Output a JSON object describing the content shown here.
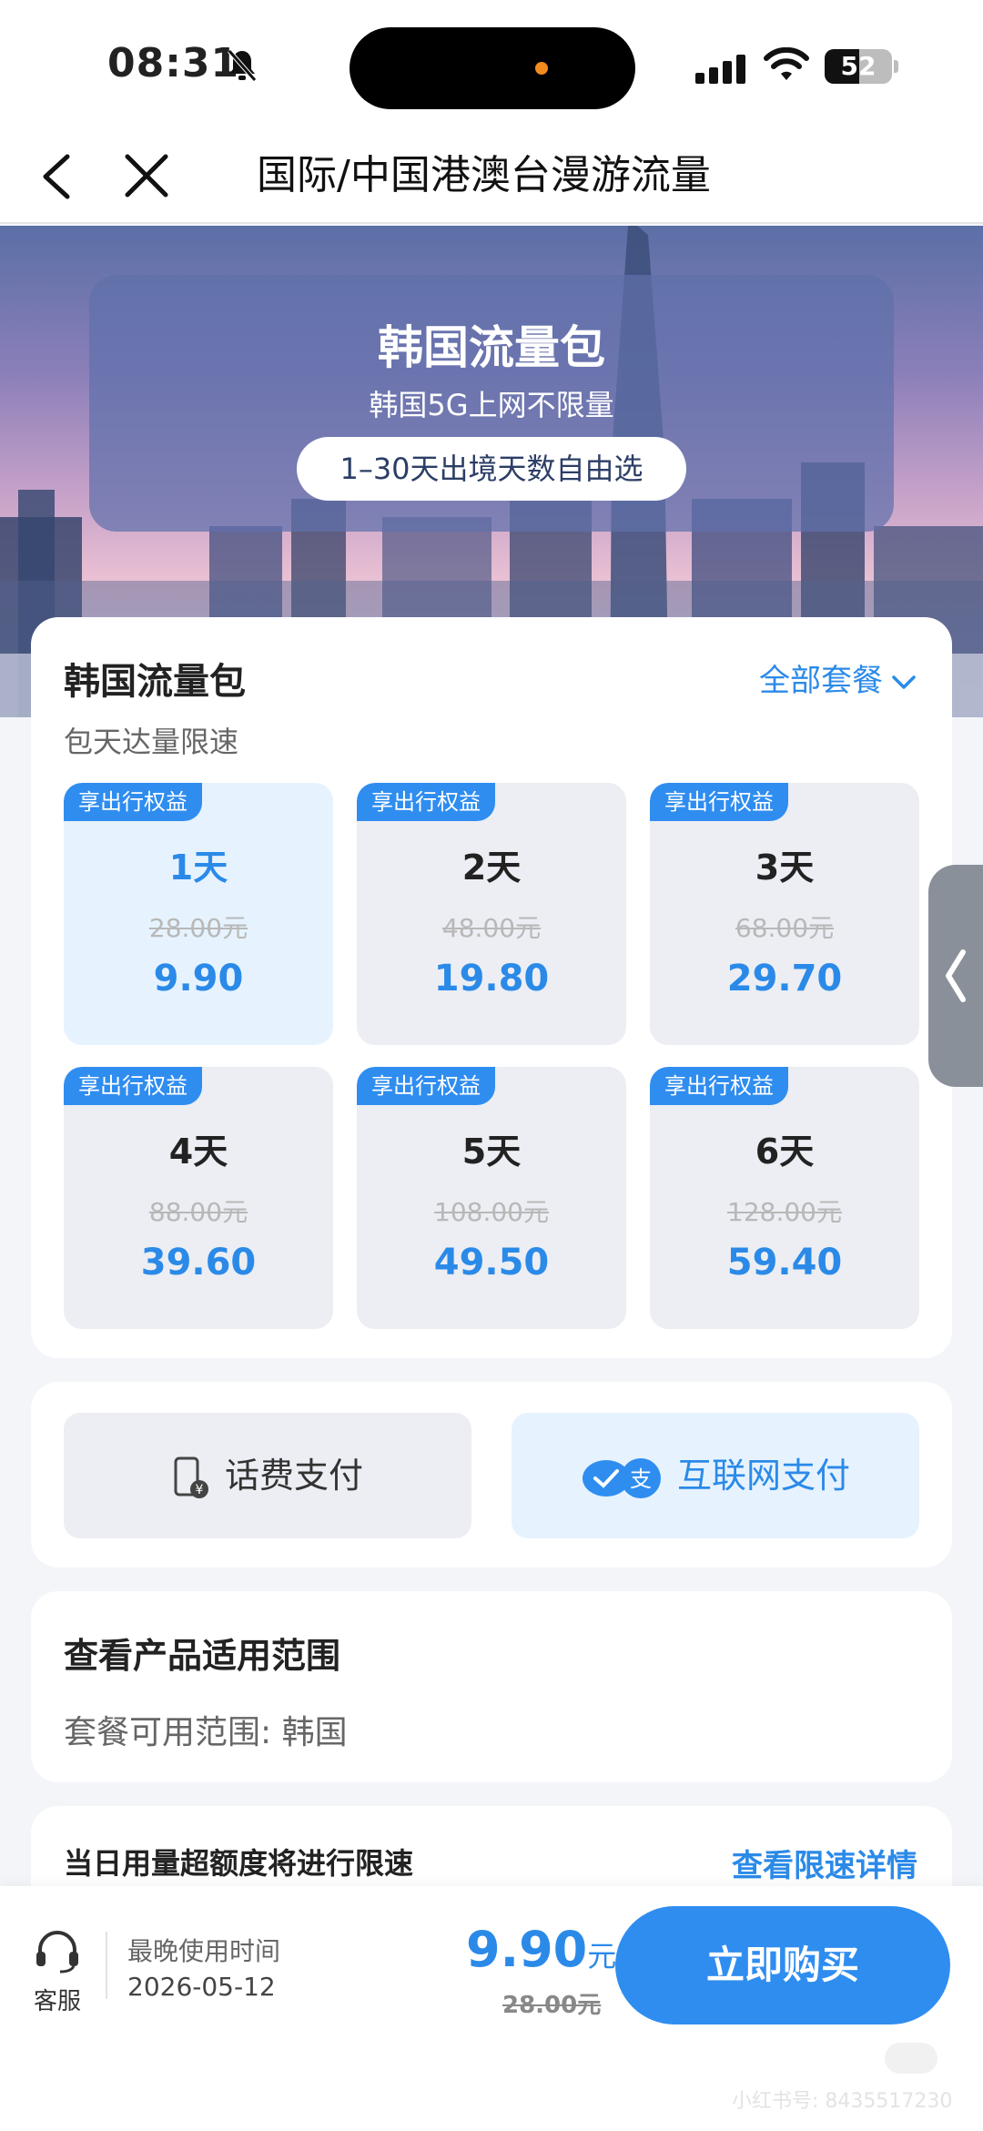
{
  "status_bar": {
    "time": "08:31",
    "battery": "52",
    "battery_level": 0.52
  },
  "nav": {
    "title": "国际/中国港澳台漫游流量"
  },
  "banner": {
    "title": "韩国流量包",
    "subtitle": "韩国5G上网不限量",
    "pill": "1–30天出境天数自由选"
  },
  "packages": {
    "title": "韩国流量包",
    "subtitle": "包天达量限速",
    "all_plans": "全部套餐",
    "items": [
      {
        "tag": "享出行权益",
        "days": "1天",
        "original": "28.00元",
        "price": "9.90",
        "selected": true
      },
      {
        "tag": "享出行权益",
        "days": "2天",
        "original": "48.00元",
        "price": "19.80"
      },
      {
        "tag": "享出行权益",
        "days": "3天",
        "original": "68.00元",
        "price": "29.70"
      },
      {
        "tag": "享出行权益",
        "days": "4天",
        "original": "88.00元",
        "price": "39.60"
      },
      {
        "tag": "享出行权益",
        "days": "5天",
        "original": "108.00元",
        "price": "49.50"
      },
      {
        "tag": "享出行权益",
        "days": "6天",
        "original": "128.00元",
        "price": "59.40"
      }
    ]
  },
  "payment": {
    "phone_bill": "话费支付",
    "internet": "互联网支付"
  },
  "scope": {
    "title": "查看产品适用范围",
    "text": "套餐可用范围: 韩国"
  },
  "limit": {
    "text": "当日用量超额度将进行限速",
    "link": "查看限速详情"
  },
  "bottom": {
    "service": "客服",
    "deadline_label": "最晚使用时间",
    "deadline": "2026-05-12",
    "price": "9.90",
    "price_unit": "元",
    "original": "28.00元",
    "buy": "立即购买"
  },
  "watermark": "小红书号: 8435517230",
  "colors": {
    "accent": "#2f8df0",
    "tag": "#2f8df0",
    "selected_bg": "#e6f3ff"
  }
}
